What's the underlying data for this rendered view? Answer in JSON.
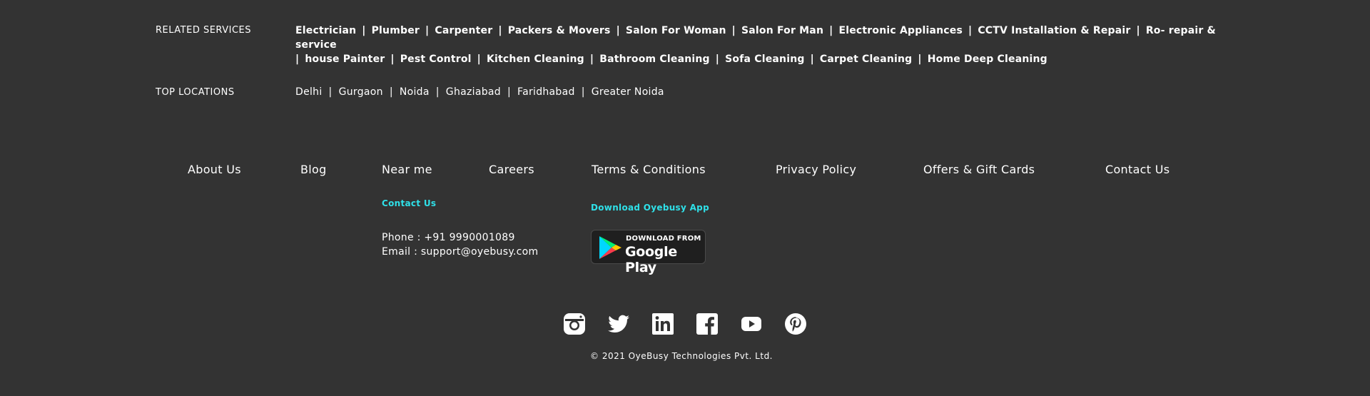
{
  "related_services": {
    "label": "RELATED SERVICES",
    "line1": [
      "Electrician",
      "Plumber",
      "Carpenter",
      "Packers & Movers",
      "Salon For Woman",
      "Salon For Man",
      "Electronic Appliances",
      "CCTV Installation & Repair",
      "Ro- repair & service"
    ],
    "line2": [
      "house Painter",
      "Pest Control",
      "Kitchen Cleaning",
      "Bathroom Cleaning",
      "Sofa Cleaning",
      "Carpet Cleaning",
      "Home Deep Cleaning"
    ],
    "separator": "|"
  },
  "top_locations": {
    "label": "TOP LOCATIONS",
    "items": [
      "Delhi",
      "Gurgaon",
      "Noida",
      "Ghaziabad",
      "Faridhabad",
      "Greater Noida"
    ],
    "separator": "|"
  },
  "footer_nav": {
    "about": "About Us",
    "blog": "Blog",
    "near_me": "Near me",
    "careers": "Careers",
    "terms": "Terms & Conditions",
    "privacy": "Privacy Policy",
    "offers": "Offers & Gift Cards",
    "contact": "Contact Us"
  },
  "contact": {
    "heading": "Contact Us",
    "phone": "Phone : +91 9990001089",
    "email": "Email : support@oyebusy.com"
  },
  "app": {
    "heading": "Download Oyebusy App",
    "badge_small": "DOWNLOAD FROM",
    "badge_big": "Google Play"
  },
  "social_icons": [
    "instagram-icon",
    "twitter-icon",
    "linkedin-icon",
    "facebook-icon",
    "youtube-icon",
    "pinterest-icon"
  ],
  "copyright": "© 2021 OyeBusy Technologies Pvt. Ltd.",
  "colors": {
    "background": "#333333",
    "text": "#ffffff",
    "accent": "#2fe0e8"
  }
}
